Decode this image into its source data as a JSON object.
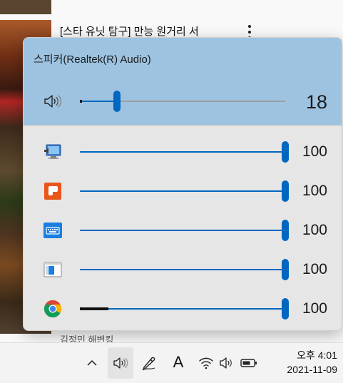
{
  "background": {
    "video_title": "[스타 유닛 탐구] 만능 원거리 서",
    "video_subtitle": "김정민 해변킹"
  },
  "mixer": {
    "device_name": "스피커(Realtek(R) Audio)",
    "master": {
      "icon": "speaker-icon",
      "volume": 18,
      "volume_label": "18"
    },
    "apps": [
      {
        "icon": "system-sounds-icon",
        "volume": 100,
        "volume_label": "100",
        "meter": 0
      },
      {
        "icon": "orange-app-icon",
        "volume": 100,
        "volume_label": "100",
        "meter": 0
      },
      {
        "icon": "keyboard-app-icon",
        "volume": 100,
        "volume_label": "100",
        "meter": 0
      },
      {
        "icon": "window-app-icon",
        "volume": 100,
        "volume_label": "100",
        "meter": 0
      },
      {
        "icon": "chrome-icon",
        "volume": 100,
        "volume_label": "100",
        "meter": 14
      }
    ]
  },
  "taskbar": {
    "chevron": "^",
    "ime": "A",
    "time": "오후 4:01",
    "date": "2021-11-09"
  },
  "colors": {
    "accent": "#0067c0",
    "header": "#9dc3e1",
    "panel": "#e6e6e6"
  }
}
